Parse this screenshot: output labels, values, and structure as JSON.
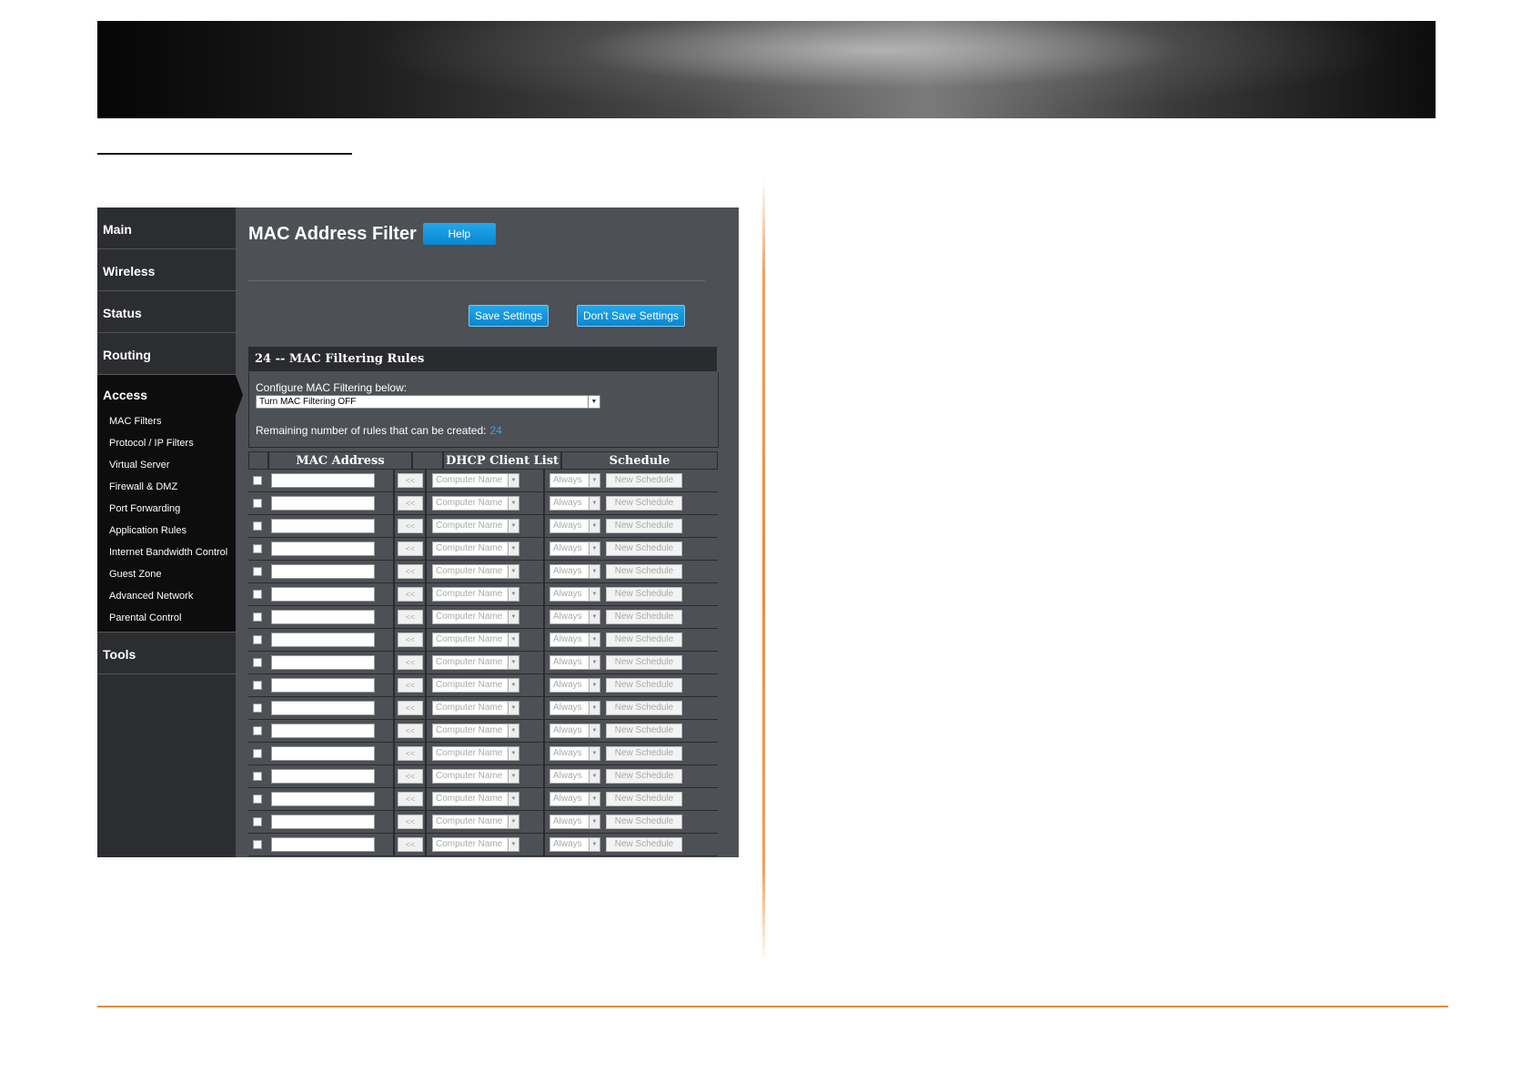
{
  "sidebar": {
    "nav": [
      {
        "id": "main",
        "label": "Main"
      },
      {
        "id": "wireless",
        "label": "Wireless"
      },
      {
        "id": "status",
        "label": "Status"
      },
      {
        "id": "routing",
        "label": "Routing"
      },
      {
        "id": "access",
        "label": "Access",
        "active": true
      },
      {
        "id": "tools",
        "label": "Tools"
      }
    ],
    "access_sub": [
      "MAC Filters",
      "Protocol / IP Filters",
      "Virtual Server",
      "Firewall & DMZ",
      "Port Forwarding",
      "Application Rules",
      "Internet Bandwidth Control",
      "Guest Zone",
      "Advanced Network",
      "Parental Control"
    ]
  },
  "main": {
    "title": "MAC Address Filter",
    "help_label": "Help",
    "save_label": "Save Settings",
    "dont_save_label": "Don't Save Settings",
    "rules_header": "24 -- MAC Filtering Rules",
    "configure_label": "Configure MAC Filtering below:",
    "mode_value": "Turn MAC Filtering OFF",
    "remaining_label": "Remaining number of rules that can be created:",
    "remaining_count": "24"
  },
  "table": {
    "headers": [
      "MAC Address",
      "DHCP Client List",
      "Schedule"
    ],
    "copy_label": "<<",
    "computer_placeholder": "Computer Name",
    "schedule_value": "Always",
    "new_schedule_label": "New Schedule",
    "visible_rows": 17
  },
  "colors": {
    "accent_blue": "#0887d0",
    "orange_rule": "#e8893c",
    "panel_bg": "#4d5055",
    "sidebar_bg": "#2c2d30"
  }
}
